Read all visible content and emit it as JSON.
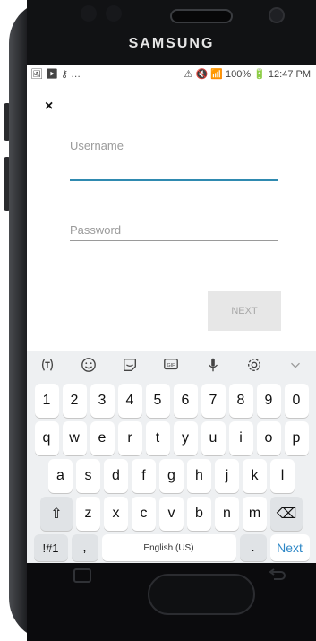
{
  "device": {
    "brand": "SAMSUNG"
  },
  "status_bar": {
    "left_icons": "🖼 ▶ ⚷ …",
    "right_text": "⚠ 🔇 📶 100% 🔋 12:47 PM"
  },
  "login": {
    "close_label": "×",
    "username_label": "Username",
    "password_label": "Password",
    "next_label": "NEXT"
  },
  "keyboard": {
    "toolbar_icons": [
      "text-icon",
      "emoji-icon",
      "sticker-icon",
      "gif-icon",
      "microphone-icon",
      "settings-icon",
      "chevron-down-icon"
    ],
    "rows": [
      [
        "1",
        "2",
        "3",
        "4",
        "5",
        "6",
        "7",
        "8",
        "9",
        "0"
      ],
      [
        "q",
        "w",
        "e",
        "r",
        "t",
        "y",
        "u",
        "i",
        "o",
        "p"
      ],
      [
        "a",
        "s",
        "d",
        "f",
        "g",
        "h",
        "j",
        "k",
        "l"
      ],
      [
        "z",
        "x",
        "c",
        "v",
        "b",
        "n",
        "m"
      ]
    ],
    "shift_label": "⇧",
    "backspace_label": "⌫",
    "symbols_label": "!#1",
    "comma_label": ",",
    "space_label": "English (US)",
    "period_label": ".",
    "next_label": "Next"
  }
}
